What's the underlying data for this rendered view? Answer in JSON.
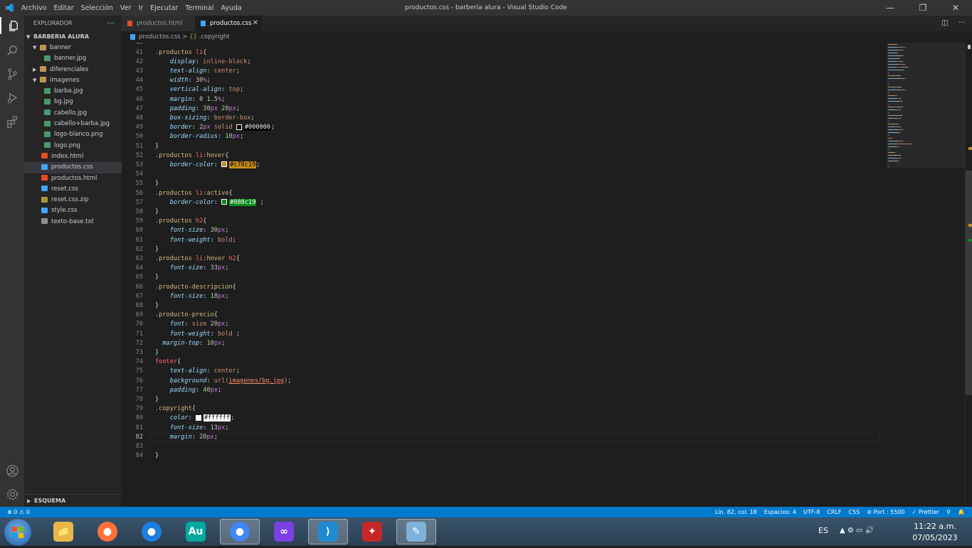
{
  "window": {
    "title": "productos.css - barbería alura - Visual Studio Code",
    "menu": [
      "Archivo",
      "Editar",
      "Selección",
      "Ver",
      "Ir",
      "Ejecutar",
      "Terminal",
      "Ayuda"
    ],
    "controls": {
      "minimize": "—",
      "restore": "❐",
      "close": "✕"
    }
  },
  "sidebar": {
    "title": "EXPLORADOR",
    "more": "···",
    "project": "BARBERIA ALURA",
    "items": [
      {
        "label": "banner",
        "kind": "folder",
        "open": true,
        "depth": 1
      },
      {
        "label": "banner.jpg",
        "kind": "img",
        "depth": 2
      },
      {
        "label": "diferenciales",
        "kind": "folder",
        "open": false,
        "depth": 1
      },
      {
        "label": "imagenes",
        "kind": "folder",
        "open": true,
        "depth": 1
      },
      {
        "label": "barba.jpg",
        "kind": "img",
        "depth": 2
      },
      {
        "label": "bg.jpg",
        "kind": "img",
        "depth": 2
      },
      {
        "label": "cabello.jpg",
        "kind": "img",
        "depth": 2
      },
      {
        "label": "cabello+barba.jpg",
        "kind": "img",
        "depth": 2
      },
      {
        "label": "logo-blanco.png",
        "kind": "img",
        "depth": 2
      },
      {
        "label": "logo.png",
        "kind": "img",
        "depth": 2
      },
      {
        "label": "index.html",
        "kind": "html",
        "depth": 1
      },
      {
        "label": "productos.css",
        "kind": "css",
        "depth": 1,
        "selected": true
      },
      {
        "label": "productos.html",
        "kind": "html",
        "depth": 1
      },
      {
        "label": "reset.css",
        "kind": "css",
        "depth": 1
      },
      {
        "label": "reset.css.zip",
        "kind": "zip",
        "depth": 1
      },
      {
        "label": "style.css",
        "kind": "css",
        "depth": 1
      },
      {
        "label": "texto-base.txt",
        "kind": "txt",
        "depth": 1
      }
    ],
    "outline": "ESQUEMA"
  },
  "tabs": [
    {
      "label": "productos.html",
      "active": false
    },
    {
      "label": "productos.css",
      "active": true
    }
  ],
  "breadcrumb": {
    "file": "productos.css",
    "symbol": ".copyright"
  },
  "editor": {
    "first_line": 41,
    "current_line": 82,
    "lines": [
      [
        [
          "t-sel",
          ".productos "
        ],
        [
          "t-tag",
          "li"
        ],
        [
          "t-pun",
          "{"
        ]
      ],
      [
        [
          "t-prop",
          "    display"
        ],
        [
          "t-pun",
          ": "
        ],
        [
          "t-val",
          "inline-block"
        ],
        [
          "t-pun",
          ";"
        ]
      ],
      [
        [
          "t-prop",
          "    text-align"
        ],
        [
          "t-pun",
          ": "
        ],
        [
          "t-val",
          "center"
        ],
        [
          "t-pun",
          ";"
        ]
      ],
      [
        [
          "t-prop",
          "    width"
        ],
        [
          "t-pun",
          ": "
        ],
        [
          "t-num",
          "30"
        ],
        [
          "t-unit",
          "%"
        ],
        [
          "t-pun",
          ";"
        ]
      ],
      [
        [
          "t-prop",
          "    vertical-align"
        ],
        [
          "t-pun",
          ": "
        ],
        [
          "t-val",
          "top"
        ],
        [
          "t-pun",
          ";"
        ]
      ],
      [
        [
          "t-prop",
          "    margin"
        ],
        [
          "t-pun",
          ": "
        ],
        [
          "t-num",
          "0 1.5"
        ],
        [
          "t-unit",
          "%"
        ],
        [
          "t-pun",
          ";"
        ]
      ],
      [
        [
          "t-prop",
          "    padding"
        ],
        [
          "t-pun",
          ": "
        ],
        [
          "t-num",
          "30"
        ],
        [
          "t-unit",
          "px "
        ],
        [
          "t-num",
          "20"
        ],
        [
          "t-unit",
          "px"
        ],
        [
          "t-pun",
          ";"
        ]
      ],
      [
        [
          "t-prop",
          "    box-sizing"
        ],
        [
          "t-pun",
          ": "
        ],
        [
          "t-val",
          "border-box"
        ],
        [
          "t-pun",
          ";"
        ]
      ],
      [
        [
          "t-prop",
          "    border"
        ],
        [
          "t-pun",
          ": "
        ],
        [
          "t-num",
          "2"
        ],
        [
          "t-unit",
          "px "
        ],
        [
          "t-val",
          "solid "
        ],
        [
          "swatch",
          "#000000"
        ],
        [
          "colorbg",
          "#000000"
        ],
        [
          "t-pun",
          ";"
        ]
      ],
      [
        [
          "t-prop",
          "    border-radius"
        ],
        [
          "t-pun",
          ": "
        ],
        [
          "t-num",
          "10"
        ],
        [
          "t-unit",
          "px"
        ],
        [
          "t-pun",
          ";"
        ]
      ],
      [
        [
          "t-pun",
          "}"
        ]
      ],
      [
        [
          "t-sel",
          ".productos "
        ],
        [
          "t-tag",
          "li"
        ],
        [
          "t-sel",
          ":hover"
        ],
        [
          "t-pun",
          "{"
        ]
      ],
      [
        [
          "t-prop",
          "    border-color"
        ],
        [
          "t-pun",
          ": "
        ],
        [
          "swatch",
          "#c78c19"
        ],
        [
          "colorbg",
          "#c78c19"
        ],
        [
          "t-pun",
          ";"
        ]
      ],
      [],
      [
        [
          "t-pun",
          "}"
        ]
      ],
      [
        [
          "t-sel",
          ".productos "
        ],
        [
          "t-tag",
          "li"
        ],
        [
          "t-sel",
          ":active"
        ],
        [
          "t-pun",
          "{"
        ]
      ],
      [
        [
          "t-prop",
          "    border-color"
        ],
        [
          "t-pun",
          ": "
        ],
        [
          "swatch",
          "#088c19"
        ],
        [
          "colorbg",
          "#088c19"
        ],
        [
          "t-pun",
          " ;"
        ]
      ],
      [
        [
          "t-pun",
          "}"
        ]
      ],
      [
        [
          "t-sel",
          ".productos "
        ],
        [
          "t-tag",
          "h2"
        ],
        [
          "t-pun",
          "{"
        ]
      ],
      [
        [
          "t-prop",
          "    font-size"
        ],
        [
          "t-pun",
          ": "
        ],
        [
          "t-num",
          "30"
        ],
        [
          "t-unit",
          "px"
        ],
        [
          "t-pun",
          ";"
        ]
      ],
      [
        [
          "t-prop",
          "    font-weight"
        ],
        [
          "t-pun",
          ": "
        ],
        [
          "t-val",
          "bold"
        ],
        [
          "t-pun",
          ";"
        ]
      ],
      [
        [
          "t-pun",
          "}"
        ]
      ],
      [
        [
          "t-sel",
          ".productos "
        ],
        [
          "t-tag",
          "li"
        ],
        [
          "t-sel",
          ":hover "
        ],
        [
          "t-tag",
          "h2"
        ],
        [
          "t-pun",
          "{"
        ]
      ],
      [
        [
          "t-prop",
          "    font-size"
        ],
        [
          "t-pun",
          ": "
        ],
        [
          "t-num",
          "33"
        ],
        [
          "t-unit",
          "px"
        ],
        [
          "t-pun",
          ";"
        ]
      ],
      [
        [
          "t-pun",
          "}"
        ]
      ],
      [
        [
          "t-sel",
          ".producto-descripcion"
        ],
        [
          "t-pun",
          "{"
        ]
      ],
      [
        [
          "t-prop",
          "    font-size"
        ],
        [
          "t-pun",
          ": "
        ],
        [
          "t-num",
          "18"
        ],
        [
          "t-unit",
          "px"
        ],
        [
          "t-pun",
          ";"
        ]
      ],
      [
        [
          "t-pun",
          "}"
        ]
      ],
      [
        [
          "t-sel",
          ".producto-precio"
        ],
        [
          "t-pun",
          "{"
        ]
      ],
      [
        [
          "t-prop",
          "    font"
        ],
        [
          "t-pun",
          ": "
        ],
        [
          "t-val",
          "size "
        ],
        [
          "t-num",
          "20"
        ],
        [
          "t-unit",
          "px"
        ],
        [
          "t-pun",
          ";"
        ]
      ],
      [
        [
          "t-prop",
          "    font-weight"
        ],
        [
          "t-pun",
          ": "
        ],
        [
          "t-val",
          "bold "
        ],
        [
          "t-pun",
          ";"
        ]
      ],
      [
        [
          "t-prop",
          "  margin-top"
        ],
        [
          "t-pun",
          ": "
        ],
        [
          "t-num",
          "10"
        ],
        [
          "t-unit",
          "px"
        ],
        [
          "t-pun",
          ";"
        ]
      ],
      [
        [
          "t-pun",
          "}"
        ]
      ],
      [
        [
          "t-tag",
          "footer"
        ],
        [
          "t-pun",
          "{"
        ]
      ],
      [
        [
          "t-prop",
          "    text-align"
        ],
        [
          "t-pun",
          ": "
        ],
        [
          "t-val",
          "center"
        ],
        [
          "t-pun",
          ";"
        ]
      ],
      [
        [
          "t-prop",
          "    background"
        ],
        [
          "t-pun",
          ": "
        ],
        [
          "t-val",
          "url("
        ],
        [
          "t-url",
          "imagenes/bg.jpg"
        ],
        [
          "t-val",
          ")"
        ],
        [
          "t-pun",
          ";"
        ]
      ],
      [
        [
          "t-prop",
          "    padding"
        ],
        [
          "t-pun",
          ": "
        ],
        [
          "t-num",
          "40"
        ],
        [
          "t-unit",
          "px"
        ],
        [
          "t-pun",
          ";"
        ]
      ],
      [
        [
          "t-pun",
          "}"
        ]
      ],
      [
        [
          "t-sel",
          ".copyright"
        ],
        [
          "t-pun",
          "{"
        ]
      ],
      [
        [
          "t-prop",
          "    color"
        ],
        [
          "t-pun",
          ": "
        ],
        [
          "swatch",
          "#ffffff"
        ],
        [
          "colorbg",
          "#ffffff"
        ],
        [
          "t-pun",
          ";"
        ]
      ],
      [
        [
          "t-prop",
          "    font-size"
        ],
        [
          "t-pun",
          ": "
        ],
        [
          "t-num",
          "13"
        ],
        [
          "t-unit",
          "px"
        ],
        [
          "t-pun",
          ";"
        ]
      ],
      [
        [
          "t-prop",
          "    margin"
        ],
        [
          "t-pun",
          ": "
        ],
        [
          "t-num",
          "20"
        ],
        [
          "t-unit",
          "px"
        ],
        [
          "t-pun",
          ";"
        ]
      ],
      [],
      [
        [
          "t-pun",
          "}"
        ]
      ]
    ]
  },
  "statusbar": {
    "errors": "⊗ 0 ⚠ 0",
    "right": [
      "Lín. 82, col. 18",
      "Espacios: 4",
      "UTF-8",
      "CRLF",
      "CSS",
      "⊘ Port : 5500",
      "✓ Prettier",
      "⚲",
      "🔔"
    ]
  },
  "taskbar": {
    "apps": [
      {
        "name": "file-explorer",
        "label": "📁",
        "color": "#e8b84a"
      },
      {
        "name": "firefox",
        "label": "●",
        "color": "#ff7139"
      },
      {
        "name": "firefox-dev",
        "label": "●",
        "color": "#1e7fe0"
      },
      {
        "name": "audition",
        "label": "Au",
        "color": "#00a99d"
      },
      {
        "name": "chrome",
        "label": "●",
        "color": "#4285f4",
        "active": true
      },
      {
        "name": "app-mask",
        "label": "∞",
        "color": "#7b3fe4"
      },
      {
        "name": "vscode",
        "label": "⟩",
        "color": "#1f8ad2",
        "active": true
      },
      {
        "name": "app-red",
        "label": "✦",
        "color": "#c62828"
      },
      {
        "name": "paint",
        "label": "✎",
        "color": "#7fb2d8",
        "active": true
      }
    ],
    "lang": "ES",
    "tray": "▲ ⚙ ▭ 🔊",
    "time": "11:22 a.m.",
    "date": "07/05/2023"
  }
}
